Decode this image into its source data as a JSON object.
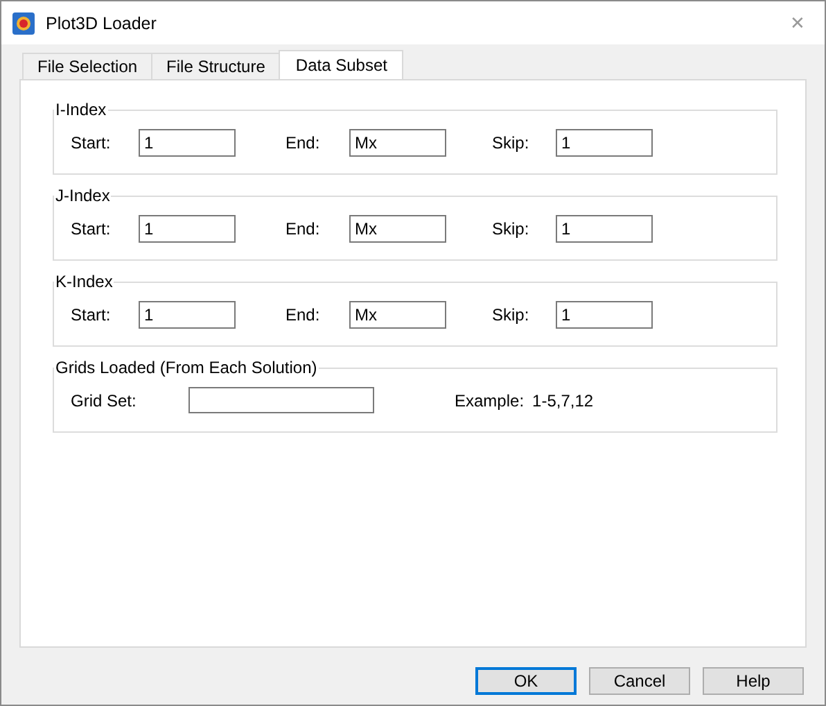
{
  "window": {
    "title": "Plot3D Loader",
    "close": "✕"
  },
  "tabs": [
    {
      "label": "File Selection",
      "selected": false
    },
    {
      "label": "File Structure",
      "selected": false
    },
    {
      "label": "Data Subset",
      "selected": true
    }
  ],
  "index_groups": [
    {
      "title": "I-Index",
      "fields": [
        {
          "label": "Start:",
          "value": "1"
        },
        {
          "label": "End:",
          "value": "Mx"
        },
        {
          "label": "Skip:",
          "value": "1"
        }
      ]
    },
    {
      "title": "J-Index",
      "fields": [
        {
          "label": "Start:",
          "value": "1"
        },
        {
          "label": "End:",
          "value": "Mx"
        },
        {
          "label": "Skip:",
          "value": "1"
        }
      ]
    },
    {
      "title": "K-Index",
      "fields": [
        {
          "label": "Start:",
          "value": "1"
        },
        {
          "label": "End:",
          "value": "Mx"
        },
        {
          "label": "Skip:",
          "value": "1"
        }
      ]
    }
  ],
  "grids_group": {
    "title": "Grids Loaded (From Each Solution)",
    "label": "Grid Set:",
    "example_label": "Example:",
    "example_value": "1-5,7,12"
  },
  "buttons": [
    {
      "label": "OK",
      "default": true
    },
    {
      "label": "Cancel",
      "default": false
    },
    {
      "label": "Help",
      "default": false
    }
  ]
}
